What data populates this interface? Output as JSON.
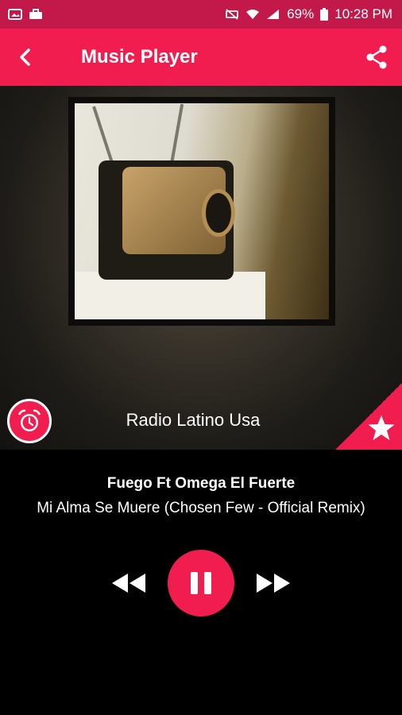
{
  "status_bar": {
    "battery": "69%",
    "time": "10:28 PM",
    "icons": [
      "image-icon",
      "briefcase-icon",
      "mute-icon",
      "wifi-icon",
      "signal-icon",
      "battery-icon"
    ]
  },
  "app_bar": {
    "title": "Music Player",
    "back_icon": "back-arrow-icon",
    "share_icon": "share-icon"
  },
  "player": {
    "station_name": "Radio Latino Usa",
    "alarm_icon": "alarm-clock-icon",
    "favorite_icon": "star-icon",
    "artist": "Fuego Ft Omega El Fuerte",
    "track": "Mi Alma Se Muere (Chosen Few - Official Remix)",
    "controls": [
      "rewind-icon",
      "pause-icon",
      "fast-forward-icon"
    ]
  },
  "colors": {
    "accent": "#f21d4f",
    "status_bar": "#c2184a",
    "background": "#000000"
  }
}
